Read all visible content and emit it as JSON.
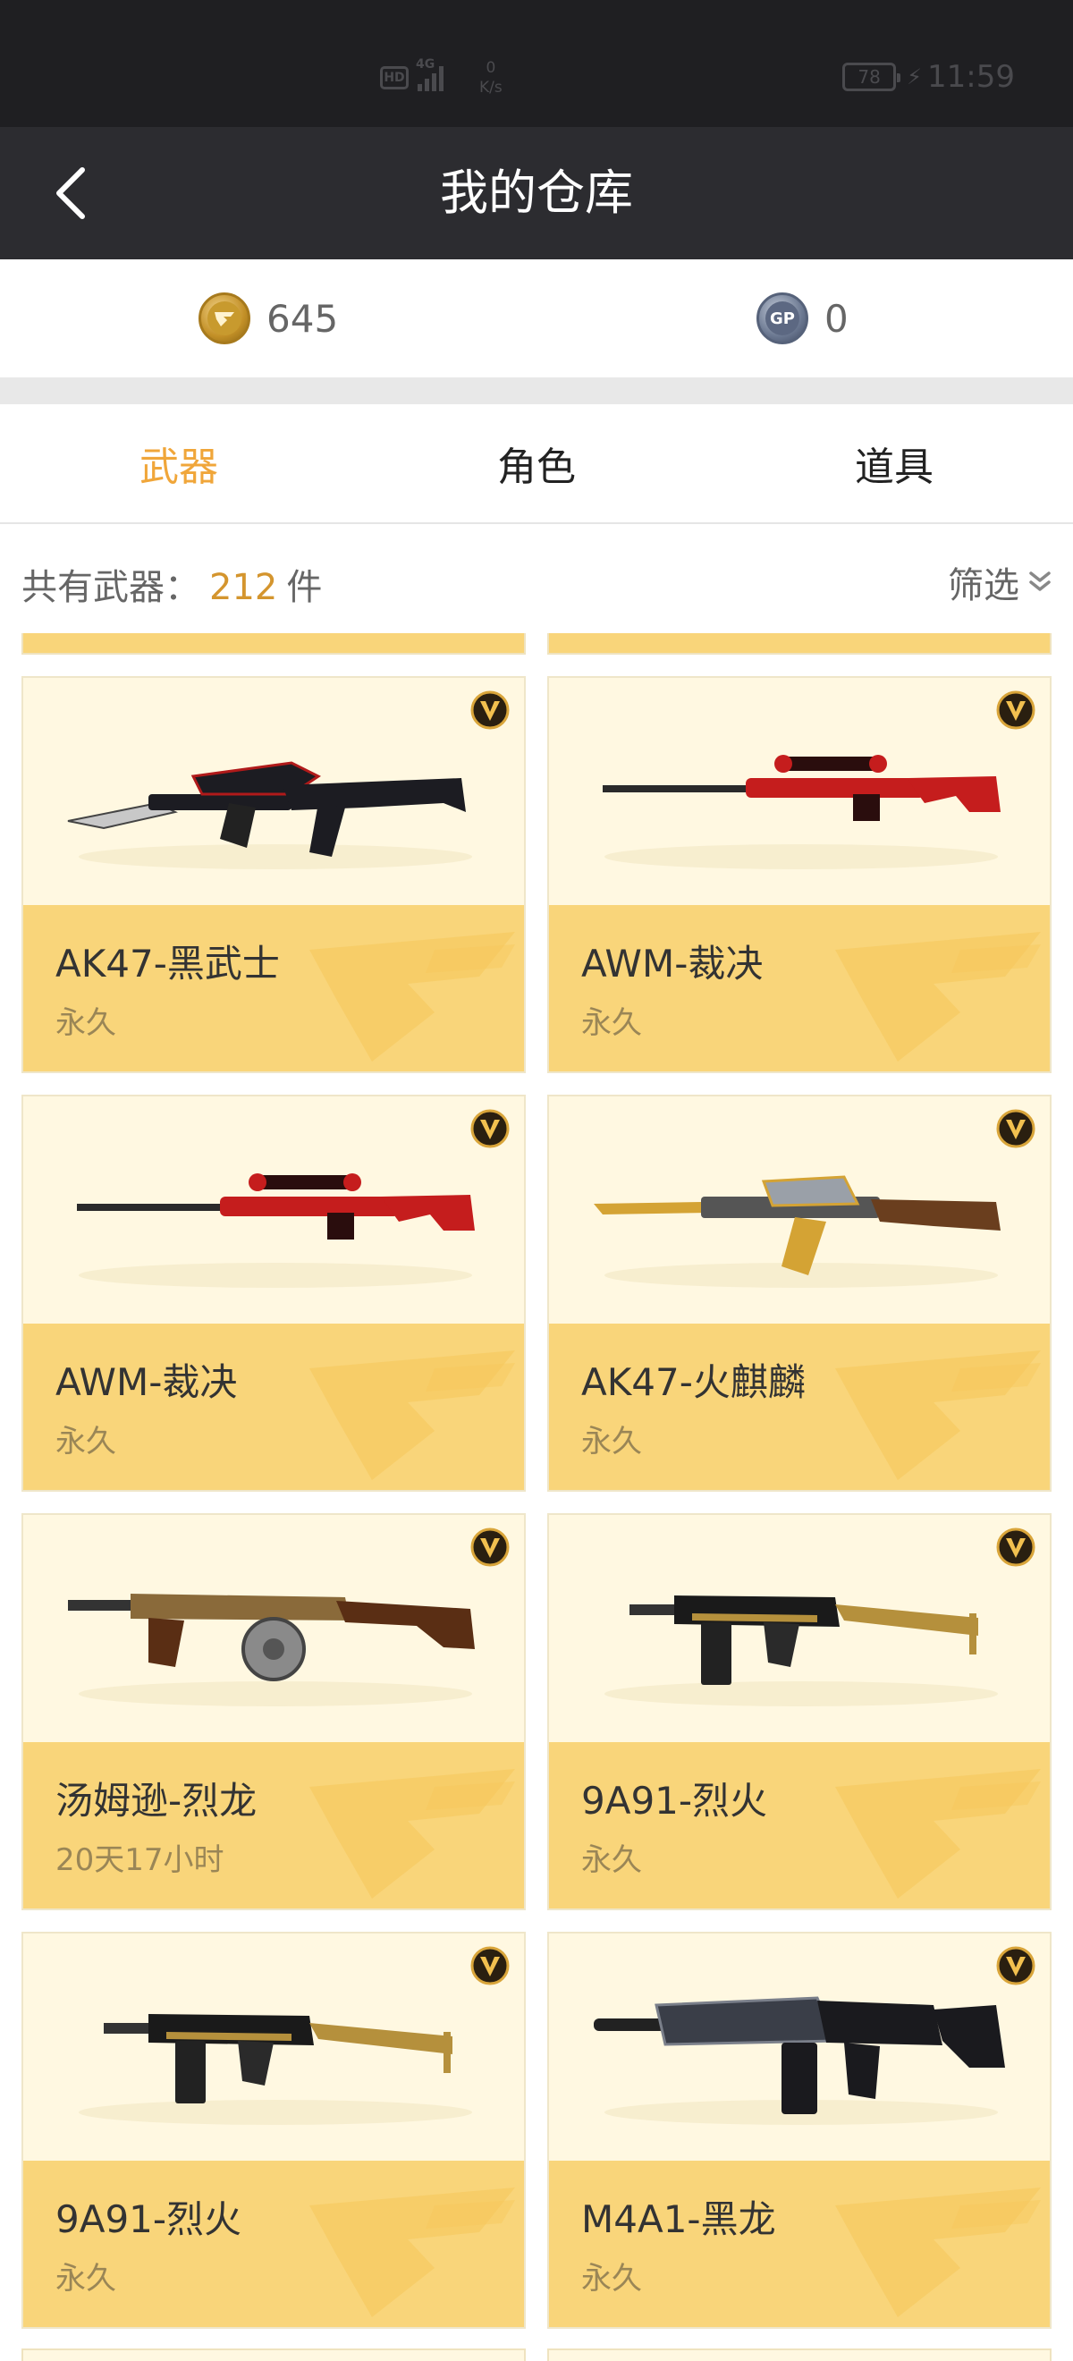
{
  "status_bar": {
    "hd": "HD",
    "signal_type": "4G",
    "speed_value": "0",
    "speed_unit": "K/s",
    "battery": "78",
    "time": "11:59"
  },
  "header": {
    "title": "我的仓库",
    "back_icon": "chevron-left-icon"
  },
  "currency": {
    "cf_coin": {
      "icon": "cf-coin-icon",
      "value": "645"
    },
    "gp_coin": {
      "icon": "gp-coin-icon",
      "label": "GP",
      "value": "0"
    }
  },
  "tabs": [
    {
      "label": "武器",
      "active": true
    },
    {
      "label": "角色",
      "active": false
    },
    {
      "label": "道具",
      "active": false
    }
  ],
  "summary": {
    "prefix": "共有武器：",
    "count": "212",
    "unit": "件",
    "filter_label": "筛选"
  },
  "colors": {
    "accent": "#f0a63a",
    "card_bottom": "#f9d57a",
    "card_top": "#fff8e1",
    "nav_bg": "#2c2c30"
  },
  "items": [
    {
      "name": "AK47-黑武士",
      "duration": "永久",
      "weapon": "rifle-blade",
      "color": "#1c1c22",
      "accent": "#b01a1a"
    },
    {
      "name": "AWM-裁决",
      "duration": "永久",
      "weapon": "sniper",
      "color": "#2a0d0d",
      "accent": "#c51d1d"
    },
    {
      "name": "AWM-裁决",
      "duration": "永久",
      "weapon": "sniper",
      "color": "#2a0d0d",
      "accent": "#c51d1d"
    },
    {
      "name": "AK47-火麒麟",
      "duration": "永久",
      "weapon": "rifle-gold",
      "color": "#3a2a14",
      "accent": "#d4a334"
    },
    {
      "name": "汤姆逊-烈龙",
      "duration": "20天17小时",
      "weapon": "thompson",
      "color": "#4a2e1a",
      "accent": "#8a6a3a"
    },
    {
      "name": "9A91-烈火",
      "duration": "永久",
      "weapon": "smg",
      "color": "#1a1a1a",
      "accent": "#b5903c"
    },
    {
      "name": "9A91-烈火",
      "duration": "永久",
      "weapon": "smg",
      "color": "#1a1a1a",
      "accent": "#b5903c"
    },
    {
      "name": "M4A1-黑龙",
      "duration": "永久",
      "weapon": "m4",
      "color": "#1a1a1e",
      "accent": "#7a7f8a"
    }
  ]
}
